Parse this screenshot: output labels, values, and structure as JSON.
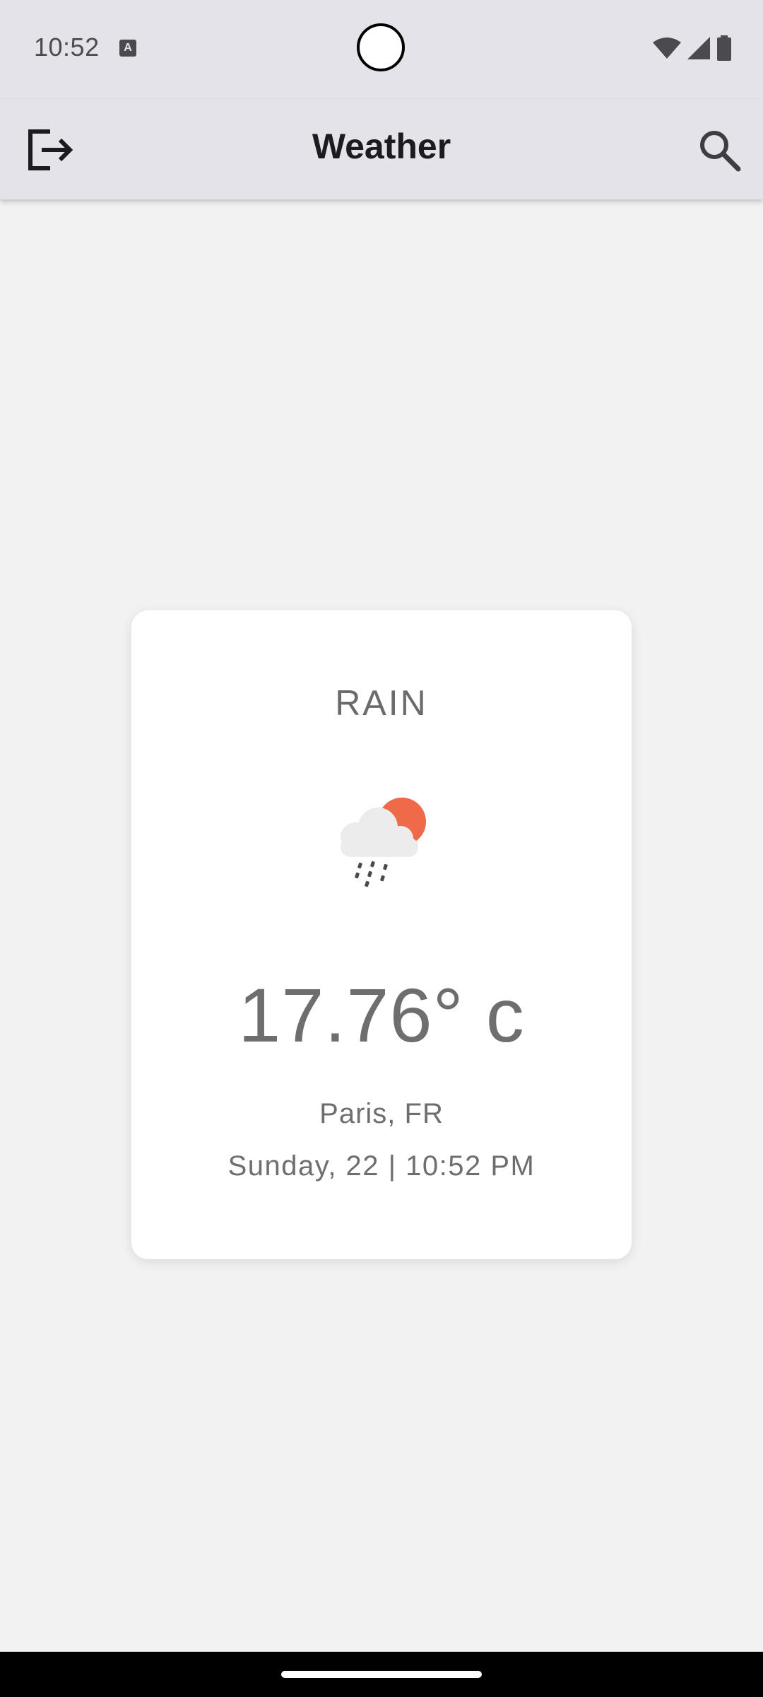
{
  "status_bar": {
    "time": "10:52",
    "notification_icon": "A"
  },
  "app_bar": {
    "title": "Weather",
    "left_icon": "logout-icon",
    "right_icon": "search-icon"
  },
  "weather": {
    "condition": "RAIN",
    "icon": "rain-cloud-sun-icon",
    "temperature": "17.76° c",
    "location": "Paris, FR",
    "datetime": "Sunday, 22 | 10:52 PM"
  },
  "colors": {
    "bar_background": "#e4e3e9",
    "page_background": "#f2f2f3",
    "sun": "#ef6a48",
    "text_gray": "#6e6e6e"
  }
}
